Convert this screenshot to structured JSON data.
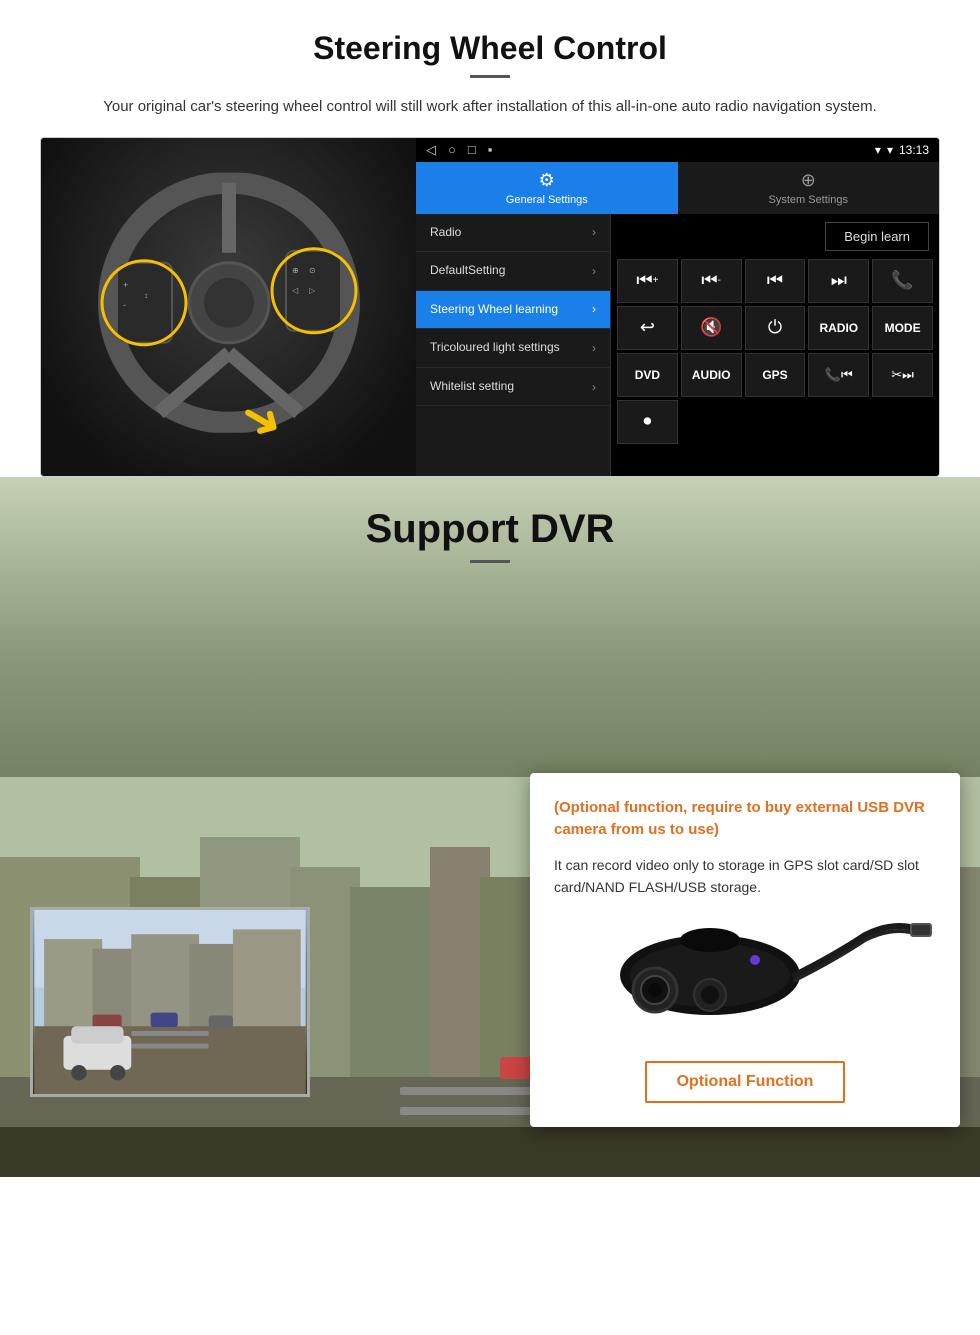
{
  "page": {
    "section1": {
      "title": "Steering Wheel Control",
      "description": "Your original car's steering wheel control will still work after installation of this all-in-one auto radio navigation system.",
      "status_bar": {
        "nav_icons": [
          "◁",
          "○",
          "□",
          "▪"
        ],
        "signal": "▾",
        "wifi": "▾",
        "time": "13:13"
      },
      "tabs": [
        {
          "id": "general",
          "icon": "⚙",
          "label": "General Settings",
          "active": true
        },
        {
          "id": "system",
          "icon": "⊕",
          "label": "System Settings",
          "active": false
        }
      ],
      "menu_items": [
        {
          "label": "Radio",
          "active": false
        },
        {
          "label": "DefaultSetting",
          "active": false
        },
        {
          "label": "Steering Wheel learning",
          "active": true
        },
        {
          "label": "Tricoloured light settings",
          "active": false
        },
        {
          "label": "Whitelist setting",
          "active": false
        }
      ],
      "begin_learn_label": "Begin learn",
      "buttons_row1": [
        "⏮+",
        "⏮-",
        "⏮",
        "⏭",
        "☎"
      ],
      "buttons_row2": [
        "↩",
        "🔇×",
        "⏻",
        "RADIO",
        "MODE"
      ],
      "buttons_row3": [
        "DVD",
        "AUDIO",
        "GPS",
        "📞⏮",
        "✂⏭"
      ],
      "buttons_row4": [
        "⏺"
      ]
    },
    "section2": {
      "title": "Support DVR",
      "orange_text": "(Optional function, require to buy external USB DVR camera from us to use)",
      "body_text": "It can record video only to storage in GPS slot card/SD slot card/NAND FLASH/USB storage.",
      "optional_function_label": "Optional Function"
    }
  }
}
